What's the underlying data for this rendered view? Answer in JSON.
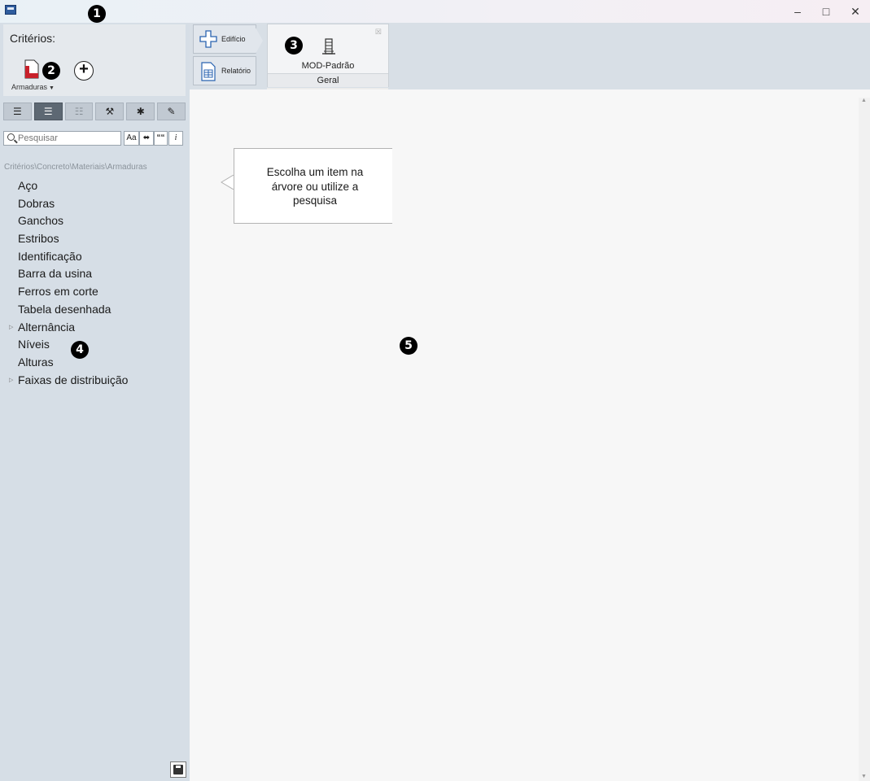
{
  "window": {
    "minimize_icon": "minimize-icon",
    "maximize_icon": "maximize-icon",
    "close_icon": "close-icon",
    "minimize_glyph": "–",
    "maximize_glyph": "□",
    "close_glyph": "✕"
  },
  "markers": [
    "1",
    "2",
    "3",
    "4",
    "5"
  ],
  "sidebar": {
    "title": "Critérios:",
    "category_label": "Armaduras",
    "add_glyph": "+",
    "toolbar_icons": [
      "list-icon",
      "list-detailed-icon",
      "list-grid-icon",
      "wrench-icon",
      "asterisk-icon",
      "pencil-icon"
    ],
    "toolbar_glyphs": [
      "☰",
      "☰",
      "☷",
      "⚒",
      "✱",
      "✎"
    ],
    "search": {
      "placeholder": "Pesquisar",
      "options": [
        "Aa",
        "⬌",
        "““",
        "i"
      ]
    },
    "path": "Critérios\\Concreto\\Materiais\\Armaduras",
    "tree": [
      {
        "label": "Aço",
        "expandable": false
      },
      {
        "label": "Dobras",
        "expandable": false
      },
      {
        "label": "Ganchos",
        "expandable": false
      },
      {
        "label": "Estribos",
        "expandable": false
      },
      {
        "label": "Identificação",
        "expandable": false
      },
      {
        "label": "Barra da usina",
        "expandable": false
      },
      {
        "label": "Ferros em corte",
        "expandable": false
      },
      {
        "label": "Tabela desenhada",
        "expandable": false
      },
      {
        "label": "Alternância",
        "expandable": true
      },
      {
        "label": "Níveis",
        "expandable": false
      },
      {
        "label": "Alturas",
        "expandable": false
      },
      {
        "label": "Faixas de distribuição",
        "expandable": true
      }
    ]
  },
  "ribbon": {
    "building_button": "Edifício",
    "report_button": "Relatório",
    "card": {
      "name": "MOD-Padrão",
      "category": "Geral",
      "close_glyph": "☒"
    }
  },
  "main": {
    "hint_line1": "Escolha um item na",
    "hint_line2": "árvore ou utilize a",
    "hint_line3": "pesquisa"
  },
  "colors": {
    "sidebar_bg": "#d6dee6",
    "ribbon_bg": "#d8dfe6",
    "content_bg": "#f7f7f7",
    "accent_red": "#c8202a"
  }
}
